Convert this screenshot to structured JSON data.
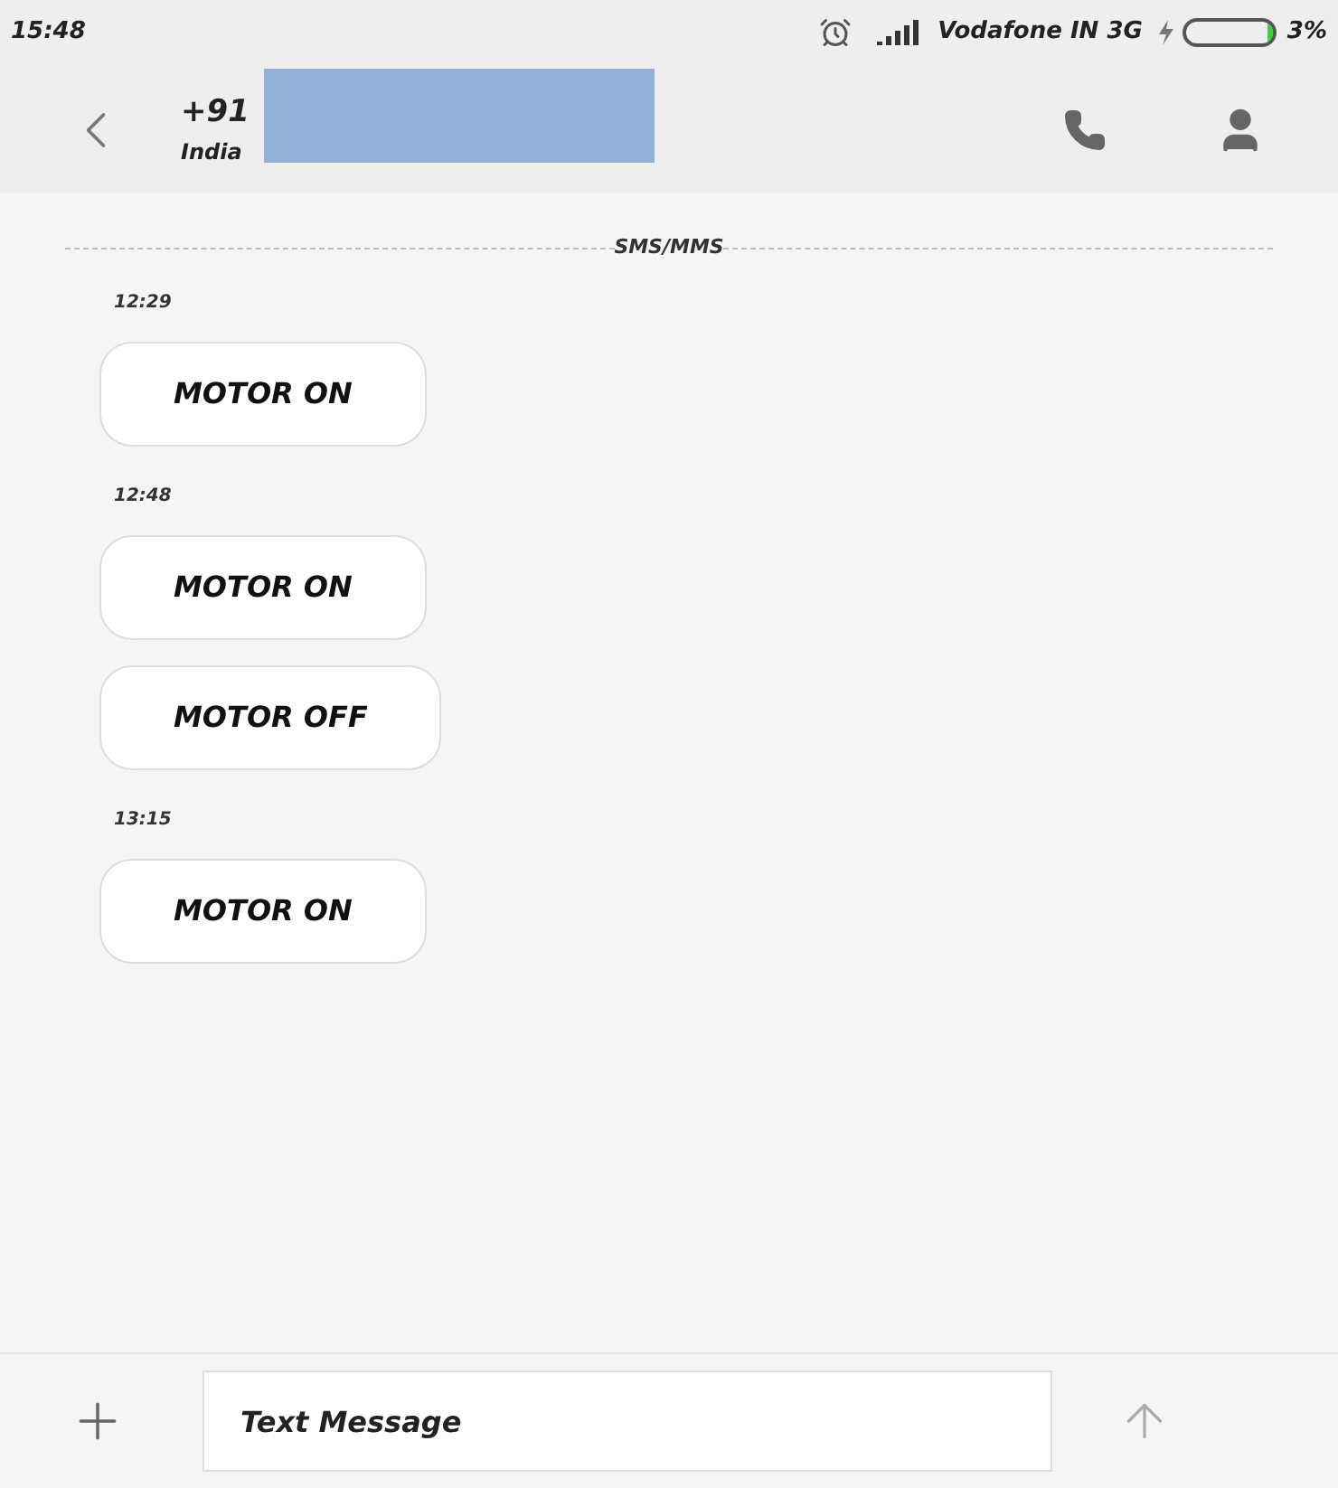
{
  "status_bar": {
    "time": "15:48",
    "carrier": "Vodafone IN 3G",
    "battery": {
      "level": 0.03,
      "reading": "3%"
    }
  },
  "header": {
    "number": "+91",
    "region": "India",
    "redacted": true
  },
  "divider_label": "SMS/MMS",
  "groups": [
    {
      "time": "12:29",
      "messages": [
        "MOTOR ON"
      ]
    },
    {
      "time": "12:48",
      "messages": [
        "MOTOR ON",
        "MOTOR OFF"
      ]
    },
    {
      "time": "13:15",
      "messages": [
        "MOTOR ON"
      ]
    }
  ],
  "composer": {
    "placeholder": "Text Message"
  }
}
